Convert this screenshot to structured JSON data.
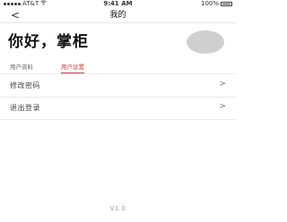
{
  "status_bar": {
    "carrier": "AT&T",
    "time": "9:41 AM",
    "battery": "100%"
  },
  "nav": {
    "back_symbol": "<",
    "title": "我的"
  },
  "profile": {
    "greeting": "你好，掌柜"
  },
  "tabs": [
    {
      "label": "用户资料",
      "active": false
    },
    {
      "label": "用户设置",
      "active": true
    }
  ],
  "menu": [
    {
      "label": "修改密码",
      "chevron": ">"
    },
    {
      "label": "退出登录",
      "chevron": ">"
    }
  ],
  "footer": {
    "version": "V1.0"
  },
  "colors": {
    "accent": "#d23b3b",
    "avatar": "#cfcfcf",
    "divider": "#e9e9e9"
  },
  "icons": [
    "signal-icon",
    "wifi-icon",
    "battery-icon",
    "back-arrow-icon",
    "chevron-right-icon"
  ]
}
